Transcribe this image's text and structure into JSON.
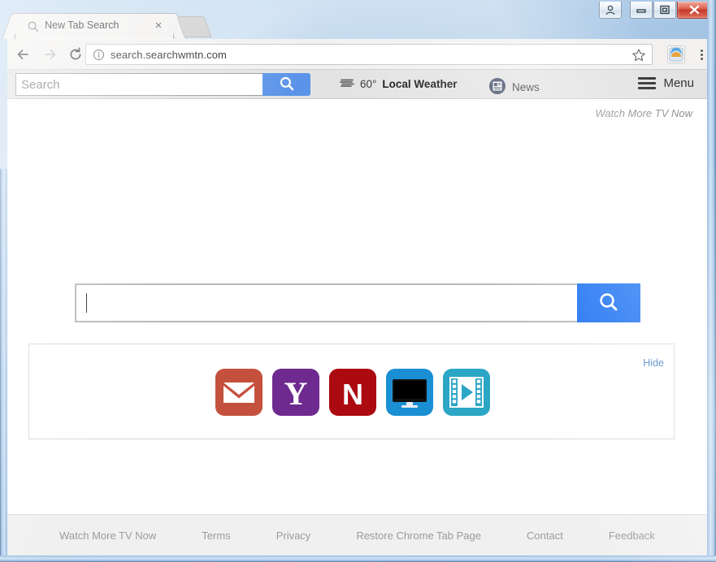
{
  "window": {
    "buttons": [
      {
        "name": "user-account",
        "icon": "user-icon"
      },
      {
        "name": "minimize",
        "icon": "minimize-icon"
      },
      {
        "name": "restore",
        "icon": "restore-icon"
      },
      {
        "name": "close",
        "icon": "close-icon"
      }
    ]
  },
  "tabstrip": {
    "tab_title": "New Tab Search",
    "favicon": "search-icon",
    "close_label": "×",
    "new_tab_label": ""
  },
  "browser_toolbar": {
    "back_icon": "arrow-left-icon",
    "forward_icon": "arrow-right-icon",
    "reload_icon": "reload-icon",
    "info_icon": "info-circle-icon",
    "url": "search.searchwmtn.com",
    "star_icon": "star-icon",
    "extension_icon": "extension-icon",
    "menu_icon": "three-dots-icon"
  },
  "ext_toolbar": {
    "search_placeholder": "Search",
    "search_value": "",
    "search_button_icon": "magnifier-icon",
    "weather": {
      "icon": "weather-icon",
      "temperature": "60°",
      "label": "Local Weather"
    },
    "news": {
      "icon": "newspaper-icon",
      "label": "News"
    },
    "menu": {
      "icon": "hamburger-icon",
      "label": "Menu"
    }
  },
  "page": {
    "watch_more_top": "Watch More TV Now",
    "search": {
      "value": "",
      "placeholder": "",
      "button_icon": "magnifier-icon",
      "button_color": "#0b67f2"
    },
    "shortcuts": {
      "hide_label": "Hide",
      "tiles": [
        {
          "name": "gmail-tile",
          "icon": "gmail-icon",
          "color": "#c4513e"
        },
        {
          "name": "yahoo-tile",
          "icon": "yahoo-icon",
          "color": "#6e2a8f"
        },
        {
          "name": "netflix-tile",
          "icon": "netflix-icon",
          "color": "#ab0a10"
        },
        {
          "name": "tv-tile",
          "icon": "monitor-icon",
          "color": "#1a8fd4"
        },
        {
          "name": "video-tile",
          "icon": "filmstrip-icon",
          "color": "#2ba6c4"
        }
      ]
    }
  },
  "footer": {
    "links": [
      "Watch More TV Now",
      "Terms",
      "Privacy",
      "Restore Chrome Tab Page",
      "Contact",
      "Feedback"
    ]
  }
}
